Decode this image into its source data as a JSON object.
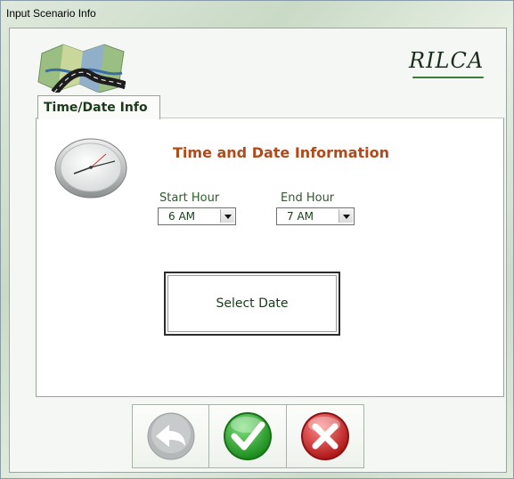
{
  "window": {
    "title": "Input Scenario Info"
  },
  "header": {
    "logo_text": "RILCA",
    "map_icon": "map-road-icon"
  },
  "tabs": [
    {
      "label": "Time/Date Info",
      "active": true
    }
  ],
  "panel": {
    "heading": "Time and Date Information",
    "clock_icon": "clock-icon",
    "start_hour": {
      "label": "Start Hour",
      "value": "6 AM"
    },
    "end_hour": {
      "label": "End Hour",
      "value": "7 AM"
    },
    "select_date_label": "Select Date"
  },
  "footer": {
    "back_icon": "back-arrow-icon",
    "ok_icon": "checkmark-icon",
    "cancel_icon": "x-close-icon"
  },
  "colors": {
    "heading": "#b04a1b",
    "label_green": "#2e5a2e",
    "ok_green": "#3bb33b",
    "cancel_red": "#d43a3a"
  }
}
